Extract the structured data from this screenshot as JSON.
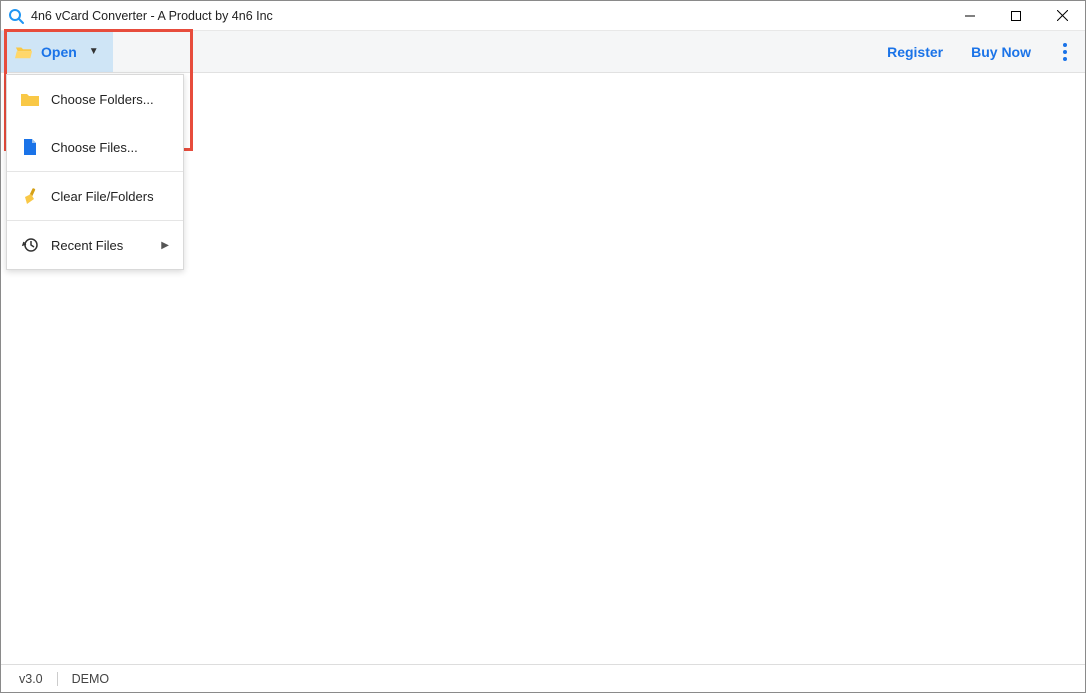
{
  "window": {
    "title": "4n6 vCard Converter - A Product by 4n6 Inc"
  },
  "toolbar": {
    "open_label": "Open",
    "register_label": "Register",
    "buy_now_label": "Buy Now"
  },
  "open_menu": {
    "choose_folders": "Choose Folders...",
    "choose_files": "Choose Files...",
    "clear": "Clear File/Folders",
    "recent": "Recent Files"
  },
  "statusbar": {
    "version": "v3.0",
    "mode": "DEMO"
  }
}
